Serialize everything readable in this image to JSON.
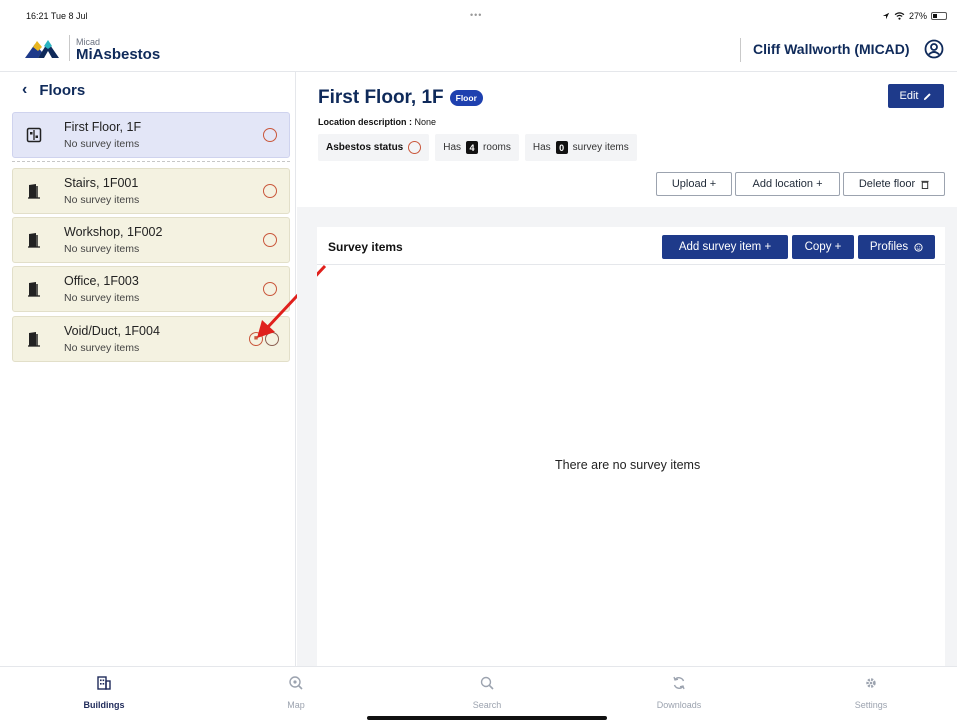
{
  "status_bar": {
    "time": "16:21  Tue 8 Jul",
    "dots": "•••",
    "battery": "27%"
  },
  "header": {
    "brand_small": "Micad",
    "brand_big": "MiAsbestos",
    "user_name": "Cliff Wallworth (MICAD)"
  },
  "sidebar": {
    "title": "Floors",
    "floor": {
      "title": "First Floor, 1F",
      "subtitle": "No survey items"
    },
    "rooms": [
      {
        "title": "Stairs, 1F001",
        "subtitle": "No survey items"
      },
      {
        "title": "Workshop, 1F002",
        "subtitle": "No survey items"
      },
      {
        "title": "Office, 1F003",
        "subtitle": "No survey items"
      },
      {
        "title": "Void/Duct, 1F004",
        "subtitle": "No survey items"
      }
    ]
  },
  "main": {
    "title": "First Floor, 1F",
    "badge": "Floor",
    "edit_label": "Edit",
    "location_label": "Location description :",
    "location_value": "None",
    "asbestos_label": "Asbestos status",
    "rooms_pre": "Has",
    "rooms_count": "4",
    "rooms_post": "rooms",
    "items_pre": "Has",
    "items_count": "0",
    "items_post": "survey items",
    "upload_label": "Upload +",
    "add_location_label": "Add location +",
    "delete_floor_label": "Delete floor"
  },
  "panel": {
    "title": "Survey items",
    "add_item_label": "Add survey item +",
    "copy_label": "Copy +",
    "profiles_label": "Profiles",
    "empty_message": "There are no survey items"
  },
  "tabs": [
    {
      "label": "Buildings"
    },
    {
      "label": "Map"
    },
    {
      "label": "Search"
    },
    {
      "label": "Downloads"
    },
    {
      "label": "Settings"
    }
  ],
  "colors": {
    "navy": "#0f2a5a",
    "primary": "#1e3a8a",
    "status_ring": "#c9573b",
    "selected_bg": "#e3e6f7",
    "room_bg": "#f4f2e1"
  }
}
